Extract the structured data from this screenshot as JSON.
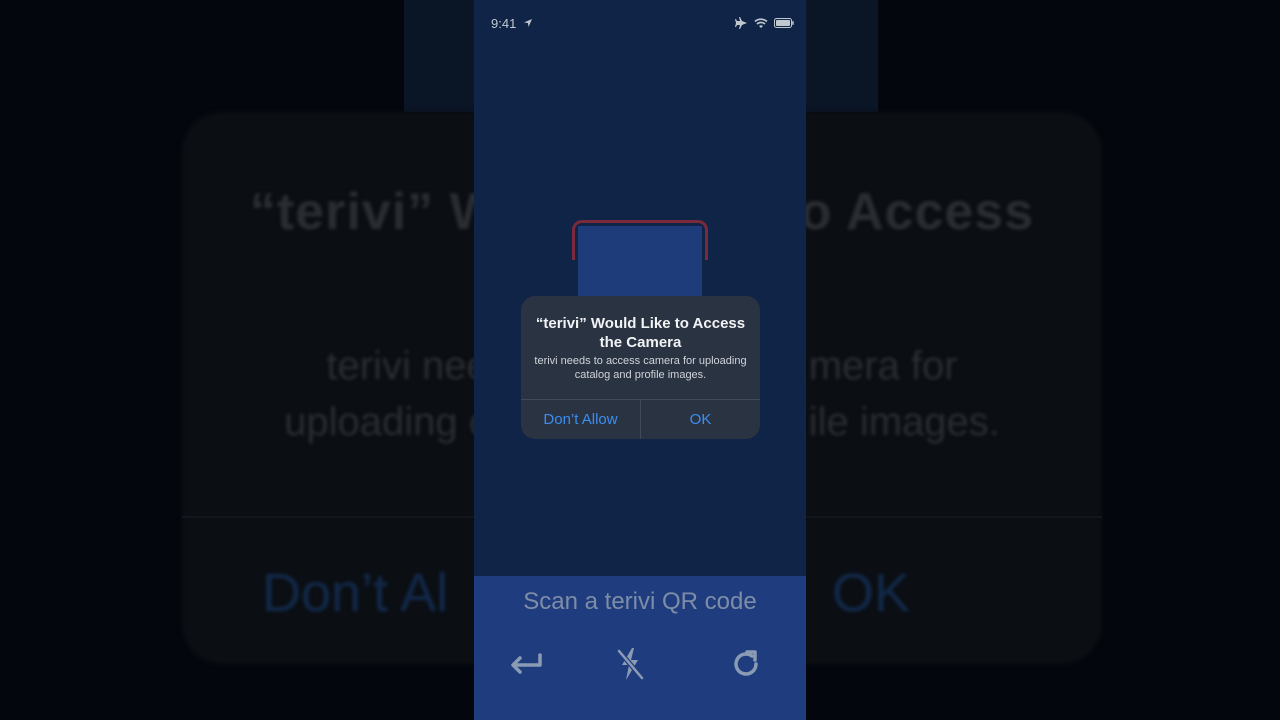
{
  "background": {
    "title_left": "“terivi” W",
    "title_right": "o Access",
    "message_line1_left": "terivi nee",
    "message_line1_right": "mera for",
    "message_line2_left": "uploading c",
    "message_line2_right": "ile images.",
    "button_left": "Don’t Al",
    "button_right": "OK"
  },
  "status_bar": {
    "time": "9:41",
    "icons": [
      "location-arrow-icon",
      "airplane-icon",
      "wifi-icon",
      "battery-icon"
    ]
  },
  "scanner": {
    "label": "Scan a terivi QR code",
    "tools": [
      "back-arrow-icon",
      "flash-off-icon",
      "refresh-icon"
    ]
  },
  "alert": {
    "title": "“terivi” Would Like to Access the Camera",
    "message": "terivi needs to access camera for uploading catalog and profile images.",
    "deny_label": "Don’t Allow",
    "ok_label": "OK"
  },
  "colors": {
    "accent": "#3b8ef0",
    "phone_bg": "#0f2447",
    "panel_bg": "#1f3d7e"
  }
}
